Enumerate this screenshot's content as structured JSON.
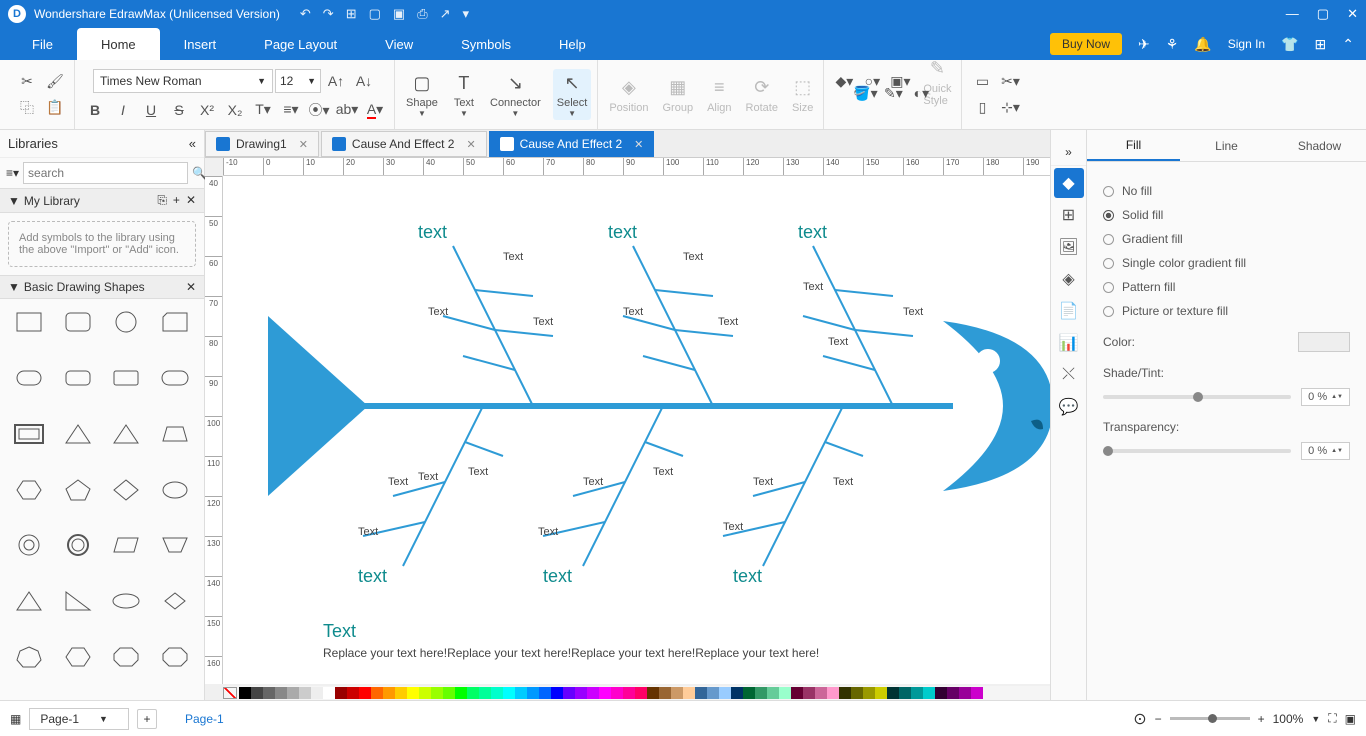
{
  "app_title": "Wondershare EdrawMax (Unlicensed Version)",
  "menu": {
    "file": "File",
    "home": "Home",
    "insert": "Insert",
    "page_layout": "Page Layout",
    "view": "View",
    "symbols": "Symbols",
    "help": "Help",
    "buy_now": "Buy Now",
    "sign_in": "Sign In"
  },
  "ribbon": {
    "font": "Times New Roman",
    "size": "12",
    "shape": "Shape",
    "text": "Text",
    "connector": "Connector",
    "select": "Select",
    "position": "Position",
    "group": "Group",
    "align": "Align",
    "rotate": "Rotate",
    "size_lbl": "Size",
    "quick_style": "Quick\nStyle"
  },
  "left": {
    "title": "Libraries",
    "search_ph": "search",
    "mylib": "My Library",
    "hint": "Add symbols to the library using the above \"Import\" or \"Add\" icon.",
    "basic": "Basic Drawing Shapes"
  },
  "tabs": {
    "t1": "Drawing1",
    "t2": "Cause And Effect 2",
    "t3": "Cause And Effect 2"
  },
  "canvas": {
    "cat_top": [
      "text",
      "text",
      "text"
    ],
    "cat_bot": [
      "text",
      "text",
      "text"
    ],
    "sub": "Text",
    "conc_title": "Text",
    "conc_body": "Replace your text here!Replace your text here!Replace your text here!Replace your text here!"
  },
  "right": {
    "fill": "Fill",
    "line": "Line",
    "shadow": "Shadow",
    "nofill": "No fill",
    "solid": "Solid fill",
    "grad": "Gradient fill",
    "single": "Single color gradient fill",
    "pattern": "Pattern fill",
    "picture": "Picture or texture fill",
    "color": "Color:",
    "shade": "Shade/Tint:",
    "trans": "Transparency:",
    "pct": "0 %"
  },
  "status": {
    "page": "Page-1",
    "page_link": "Page-1",
    "zoom": "100%"
  }
}
